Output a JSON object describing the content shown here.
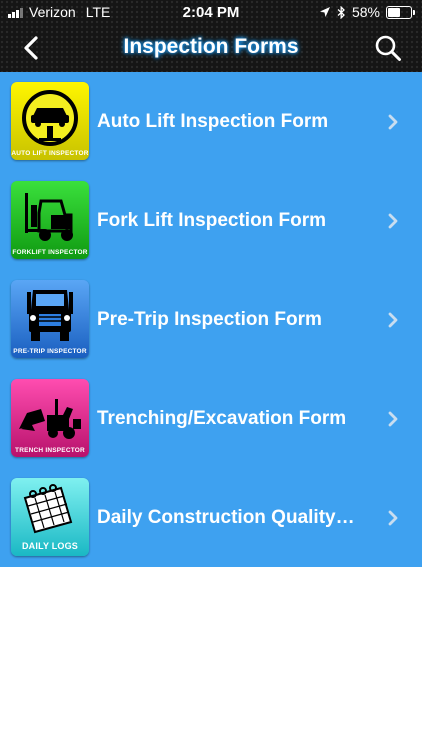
{
  "status_bar": {
    "carrier": "Verizon",
    "network": "LTE",
    "time": "2:04 PM",
    "battery": "58%",
    "battery_level": 0.58
  },
  "header": {
    "title": "Inspection Forms",
    "back_icon": "chevron-left-icon",
    "search_icon": "search-icon"
  },
  "forms": [
    {
      "label": "Auto Lift Inspection Form",
      "icon_caption": "AUTO LIFT INSPECTOR",
      "icon": "car-lift-icon",
      "icon_color": "#e8e000"
    },
    {
      "label": "Fork Lift Inspection Form",
      "icon_caption": "FORKLIFT INSPECTOR",
      "icon": "forklift-icon",
      "icon_color": "#19c21c"
    },
    {
      "label": "Pre-Trip Inspection Form",
      "icon_caption": "PRE-TRIP INSPECTOR",
      "icon": "truck-icon",
      "icon_color": "#2d7ee0"
    },
    {
      "label": "Trenching/Excavation Form",
      "icon_caption": "TRENCH INSPECTOR",
      "icon": "excavator-icon",
      "icon_color": "#e0218a"
    },
    {
      "label": "Daily Construction Quality…",
      "icon_caption": "DAILY LOGS",
      "icon": "calendar-log-icon",
      "icon_color": "#2bd0d8"
    }
  ],
  "colors": {
    "list_background": "#3ea1f0",
    "header_background": "#151515",
    "title_glow": "#1aa0ff"
  }
}
